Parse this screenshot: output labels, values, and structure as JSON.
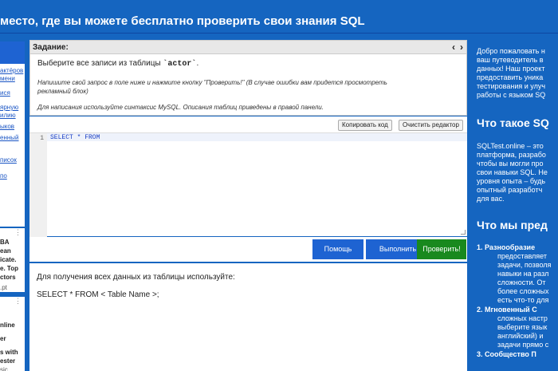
{
  "header": {
    "title": "место, где вы можете бесплатно проверить свои знания SQL"
  },
  "left_panel": {
    "links": [
      "актёров",
      "мени",
      "ися",
      "ярную",
      "илию",
      "ыков",
      "енный",
      "писок",
      "по"
    ]
  },
  "ads": {
    "ad1_lines": [
      "BA",
      "ean",
      "icate.",
      "e. Top",
      "ctors",
      ".pt"
    ],
    "ad2_lines": [
      "nline",
      "er",
      "s with",
      "ester",
      "sic"
    ]
  },
  "task": {
    "title": "Задание:",
    "prev": "‹",
    "next": "›",
    "text_prefix": "Выберите все записи из таблицы",
    "table_name": "`actor`",
    "text_suffix": ".",
    "hint": "Напишите свой запрос в поле ниже и нажмите кнопку \"Проверить!\" (В случае ошибки вам придется просмотреть рекламный блок)",
    "syntax_note": "Для написания используйте синтаксис MySQL. Описания таблиц приведены в правой панели."
  },
  "editor": {
    "copy_label": "Копировать код",
    "clear_label": "Очистить редактор",
    "line_number": "1",
    "code": "SELECT * FROM"
  },
  "actions": {
    "help_label": "Помощь",
    "run_label": "Выполнить",
    "check_label": "Проверить!"
  },
  "result": {
    "line1": "Для получения всех данных из таблицы используйте:",
    "line2": "SELECT * FROM < Table Name >;"
  },
  "right_panel": {
    "intro": [
      "Добро пожаловать н",
      "ваш путеводитель в",
      "данных! Наш проект",
      "предоставить уника",
      "тестирования и улуч",
      "работы с языком SQ"
    ],
    "heading1": "Что такое SQ",
    "about": [
      "SQLTest.online – это",
      "платформа, разрабо",
      "чтобы вы могли про",
      "свои навыки SQL. Не",
      "уровня опыта – будь",
      "опытный разработч",
      "для вас."
    ],
    "heading2": "Что мы пред",
    "list": [
      "1. Разнообразие",
      "предоставляет",
      "задачи, позволя",
      "навыки на разл",
      "сложности. От",
      "более сложных",
      "есть что-то для",
      "2. Мгновенный С",
      "сложных настр",
      "выберите язык",
      "английский) и",
      "задачи прямо с",
      "3. Сообщество П"
    ]
  },
  "colors": {
    "brand_blue": "#1565c0",
    "button_blue": "#1e63d2",
    "check_green": "#19891e"
  }
}
